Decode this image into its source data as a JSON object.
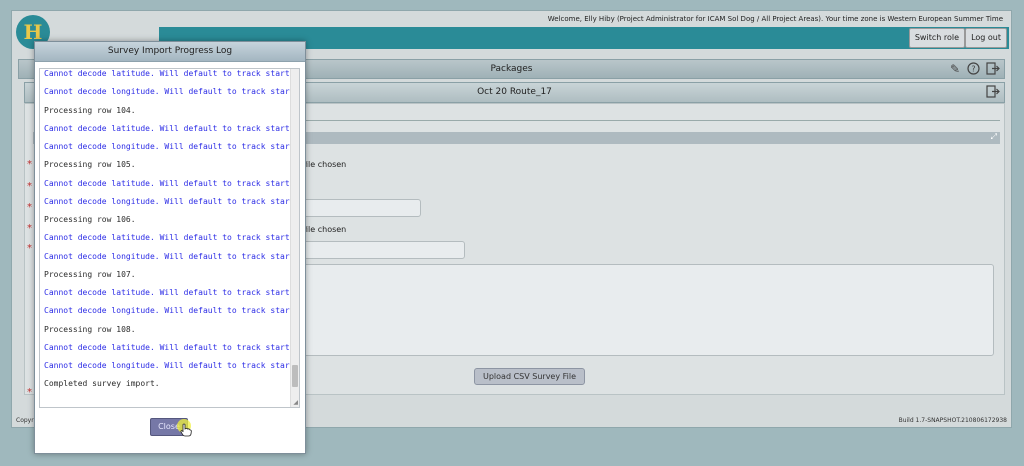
{
  "header": {
    "welcome_text": "Welcome, Elly Hiby (Project Administrator for ICAM Sol Dog / All Project Areas). Your time zone is Western European Summer Time",
    "switch_role_label": "Switch role",
    "logout_label": "Log out",
    "logo_letter": "H"
  },
  "packages": {
    "title": "Packages",
    "icons": [
      "pencil-icon",
      "help-icon",
      "exit-icon"
    ]
  },
  "route": {
    "title": "Oct 20 Route_17"
  },
  "form": {
    "file_chosen_1": "file chosen",
    "file_chosen_2": "file chosen",
    "upload_label": "Upload CSV Survey File"
  },
  "footer": {
    "copyright_fragment": "Copyr",
    "build": "Build 1.7-SNAPSHOT.210806172938"
  },
  "dialog": {
    "title": "Survey Import Progress Log",
    "close_label": "Close",
    "log_lines": [
      {
        "text": "Cannot decode latitude. Will default to track start.",
        "type": "warn"
      },
      {
        "text": "Cannot decode longitude. Will default to track start.",
        "type": "warn"
      },
      {
        "text": "Processing row 104.",
        "type": "info"
      },
      {
        "text": "Cannot decode latitude. Will default to track start.",
        "type": "warn"
      },
      {
        "text": "Cannot decode longitude. Will default to track start.",
        "type": "warn"
      },
      {
        "text": "Processing row 105.",
        "type": "info"
      },
      {
        "text": "Cannot decode latitude. Will default to track start.",
        "type": "warn"
      },
      {
        "text": "Cannot decode longitude. Will default to track start.",
        "type": "warn"
      },
      {
        "text": "Processing row 106.",
        "type": "info"
      },
      {
        "text": "Cannot decode latitude. Will default to track start.",
        "type": "warn"
      },
      {
        "text": "Cannot decode longitude. Will default to track start.",
        "type": "warn"
      },
      {
        "text": "Processing row 107.",
        "type": "info"
      },
      {
        "text": "Cannot decode latitude. Will default to track start.",
        "type": "warn"
      },
      {
        "text": "Cannot decode longitude. Will default to track start.",
        "type": "warn"
      },
      {
        "text": "Processing row 108.",
        "type": "info"
      },
      {
        "text": "Cannot decode latitude. Will default to track start.",
        "type": "warn"
      },
      {
        "text": "Cannot decode longitude. Will default to track start.",
        "type": "warn"
      },
      {
        "text": "Completed survey import.",
        "type": "info"
      }
    ]
  },
  "colors": {
    "warn_text": "#2d2de6",
    "teal": "#2a8b97",
    "close_button": "#7678a7"
  }
}
